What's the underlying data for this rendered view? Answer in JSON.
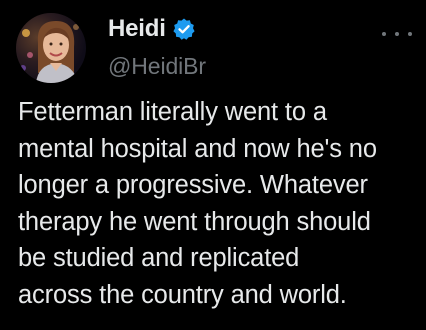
{
  "author": {
    "display_name": "Heidi",
    "handle": "@HeidiBr",
    "verified": true,
    "avatar_icon": "profile-photo-avatar",
    "verified_icon": "verified-badge-icon",
    "verified_color": "#1d9bf0"
  },
  "tweet": {
    "text": "Fetterman literally went to a\nmental hospital and now he's no\nlonger a progressive. Whatever\ntherapy he went through should\nbe studied and replicated\nacross the country and world."
  },
  "more_icon": "more-horizontal-icon",
  "colors": {
    "background": "#000000",
    "primary_text": "#e7e9ea",
    "secondary_text": "#71767b",
    "accent": "#1d9bf0"
  }
}
